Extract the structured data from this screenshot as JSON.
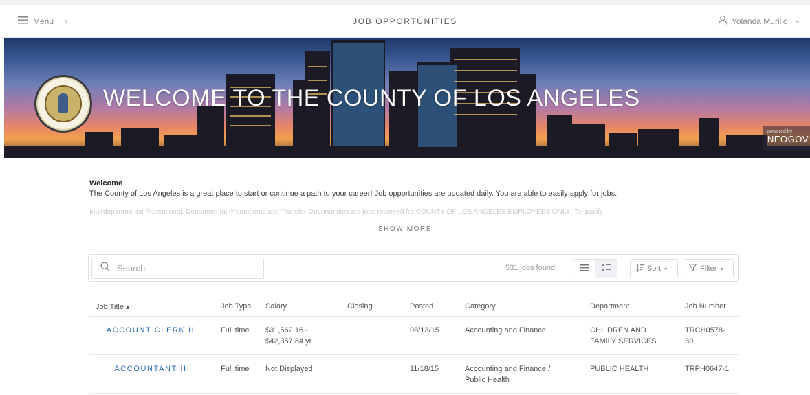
{
  "topbar": {
    "menu_label": "Menu",
    "menu_icon": "hamburger-icon",
    "title": "JOB OPPORTUNITIES",
    "user_name": "Yolanda Murillo",
    "user_icon": "user-icon"
  },
  "banner": {
    "heading": "WELCOME TO THE COUNTY OF LOS ANGELES",
    "powered_by": "powered by",
    "brand": "NEOGOV"
  },
  "intro": {
    "heading": "Welcome",
    "text": "The County of Los Angeles is a great place to start or continue a path to your career! Job opportunities are updated daily. You are able to easily apply for jobs.",
    "faded_text": "Interdepartmental Promotional, Departmental Promotional and Transfer Opportunities are jobs reserved for COUNTY OF LOS ANGELES EMPLOYEES ONLY! To qualify",
    "show_more": "SHOW MORE"
  },
  "toolbar": {
    "search_placeholder": "Search",
    "jobs_found": "531 jobs found",
    "sort_label": "Sort",
    "filter_label": "Filter"
  },
  "table": {
    "headers": {
      "title": "Job Title ▴",
      "type": "Job Type",
      "salary": "Salary",
      "closing": "Closing",
      "posted": "Posted",
      "category": "Category",
      "department": "Department",
      "number": "Job Number"
    },
    "rows": [
      {
        "title": "ACCOUNT CLERK II",
        "type": "Full time",
        "salary_1": "$31,562.16 -",
        "salary_2": "$42,357.84 yr",
        "closing": "",
        "posted": "08/13/15",
        "category_1": "Accounting and Finance",
        "category_2": "",
        "department_1": "CHILDREN AND",
        "department_2": "FAMILY SERVICES",
        "number_1": "TRCH0578-",
        "number_2": "30"
      },
      {
        "title": "ACCOUNTANT II",
        "type": "Full time",
        "salary_1": "Not Displayed",
        "salary_2": "",
        "closing": "",
        "posted": "11/18/15",
        "category_1": "Accounting and Finance /",
        "category_2": "Public Health",
        "department_1": "PUBLIC HEALTH",
        "department_2": "",
        "number_1": "TRPH0647-1",
        "number_2": ""
      }
    ]
  }
}
